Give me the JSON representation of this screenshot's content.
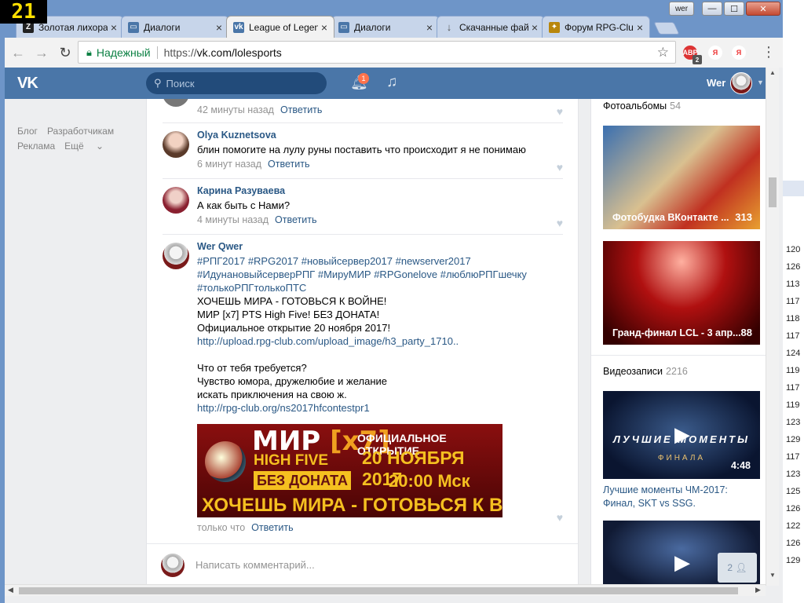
{
  "overlay_counter": "21",
  "window": {
    "user_label": "wer",
    "min": "—",
    "max": "☐",
    "close": "✕"
  },
  "tabs": [
    {
      "title": "Золотая лихорадка",
      "icon": "Z",
      "icon_color": "#222"
    },
    {
      "title": "Диалоги",
      "icon": "",
      "icon_color": "#4a76a8"
    },
    {
      "title": "League of Legends",
      "icon": "",
      "icon_color": "#4a76a8"
    },
    {
      "title": "Диалоги",
      "icon": "",
      "icon_color": "#4a76a8"
    },
    {
      "title": "Скачанные файлы",
      "icon": "↓",
      "icon_color": "#555"
    },
    {
      "title": "Форум RPG-Club",
      "icon": "",
      "icon_color": "#b8860b"
    }
  ],
  "omnibox": {
    "secure_label": "Надежный",
    "scheme": "https://",
    "host": "vk.com/lolesports"
  },
  "extensions": {
    "abp_count": "2"
  },
  "vk": {
    "search_placeholder": "Поиск",
    "notifications_count": "1",
    "user_name": "Wer",
    "left_menu": {
      "blog": "Блог",
      "devs": "Разработчикам",
      "ads": "Реклама",
      "more": "Ещё"
    }
  },
  "comments": [
    {
      "name": "",
      "text": "",
      "time": "42 минуты назад",
      "reply": "Ответить"
    },
    {
      "name": "Olya Kuznetsova",
      "text": "блин помогите на лулу руны поставить что происходит я не понимаю",
      "time": "6 минут назад",
      "reply": "Ответить"
    },
    {
      "name": "Карина Разуваева",
      "text": "А как быть с Нами?",
      "time": "4 минуты назад",
      "reply": "Ответить"
    }
  ],
  "post": {
    "name": "Wer Qwer",
    "tags": "#РПГ2017 #RPG2017 #новыйсервер2017 #newserver2017 #ИдунановыйсерверРПГ #МируМИР #RPGonelove #люблюРПГшечку #толькоРПГтолькоПТС",
    "line1": "ХОЧЕШЬ МИРА - ГОТОВЬСЯ К ВОЙНЕ!",
    "line2": "МИР [x7] PTS High Five! БЕЗ ДОНАТА!",
    "line3": "Официальное открытие 20 ноября 2017!",
    "link1": "http://upload.rpg-club.com/upload_image/h3_party_1710..",
    "line4": "Что от тебя требуется?",
    "line5": "Чувство юмора, дружелюбие и желание",
    "line6": "искать приключения на свою ж.",
    "link2": "http://rpg-club.org/ns2017hfcontestpr1",
    "time": "только что",
    "reply": "Ответить",
    "banner": {
      "mir": "МИР",
      "x7": "[x7]",
      "hf": "HIGH FIVE",
      "nodonate": "БЕЗ ДОНАТА",
      "official": "ОФИЦИАЛЬНОЕ ОТКРЫТИЕ",
      "date": "20 НОЯБРЯ 2017",
      "time": "20:00 Мск",
      "slogan": "ХОЧЕШЬ МИРА - ГОТОВЬСЯ К ВОЙНЕ"
    }
  },
  "new_comment_placeholder": "Написать комментарий...",
  "sidebar": {
    "albums_label": "Фотоальбомы",
    "albums_count": "54",
    "albums": [
      {
        "title": "Фотобудка ВКонтакте ...",
        "count": "313"
      },
      {
        "title": "Гранд-финал LCL - 3 апр...",
        "count": "88"
      }
    ],
    "videos_label": "Видеозаписи",
    "videos_count": "2216",
    "videos": [
      {
        "overlay": "ЛУЧШИЕ МОМЕНТЫ",
        "sub": "ФИНАЛА",
        "duration": "4:48",
        "title": "Лучшие моменты ЧМ-2017: Финал, SKT vs SSG."
      },
      {
        "overlay": "",
        "sub": "",
        "duration": "",
        "title": ""
      }
    ],
    "friends_online": "2"
  },
  "bg_window_numbers": [
    "120",
    "126",
    "113",
    "117",
    "118",
    "117",
    "124",
    "119",
    "117",
    "119",
    "123",
    "129",
    "117",
    "123",
    "125",
    "126",
    "122",
    "126",
    "129"
  ]
}
